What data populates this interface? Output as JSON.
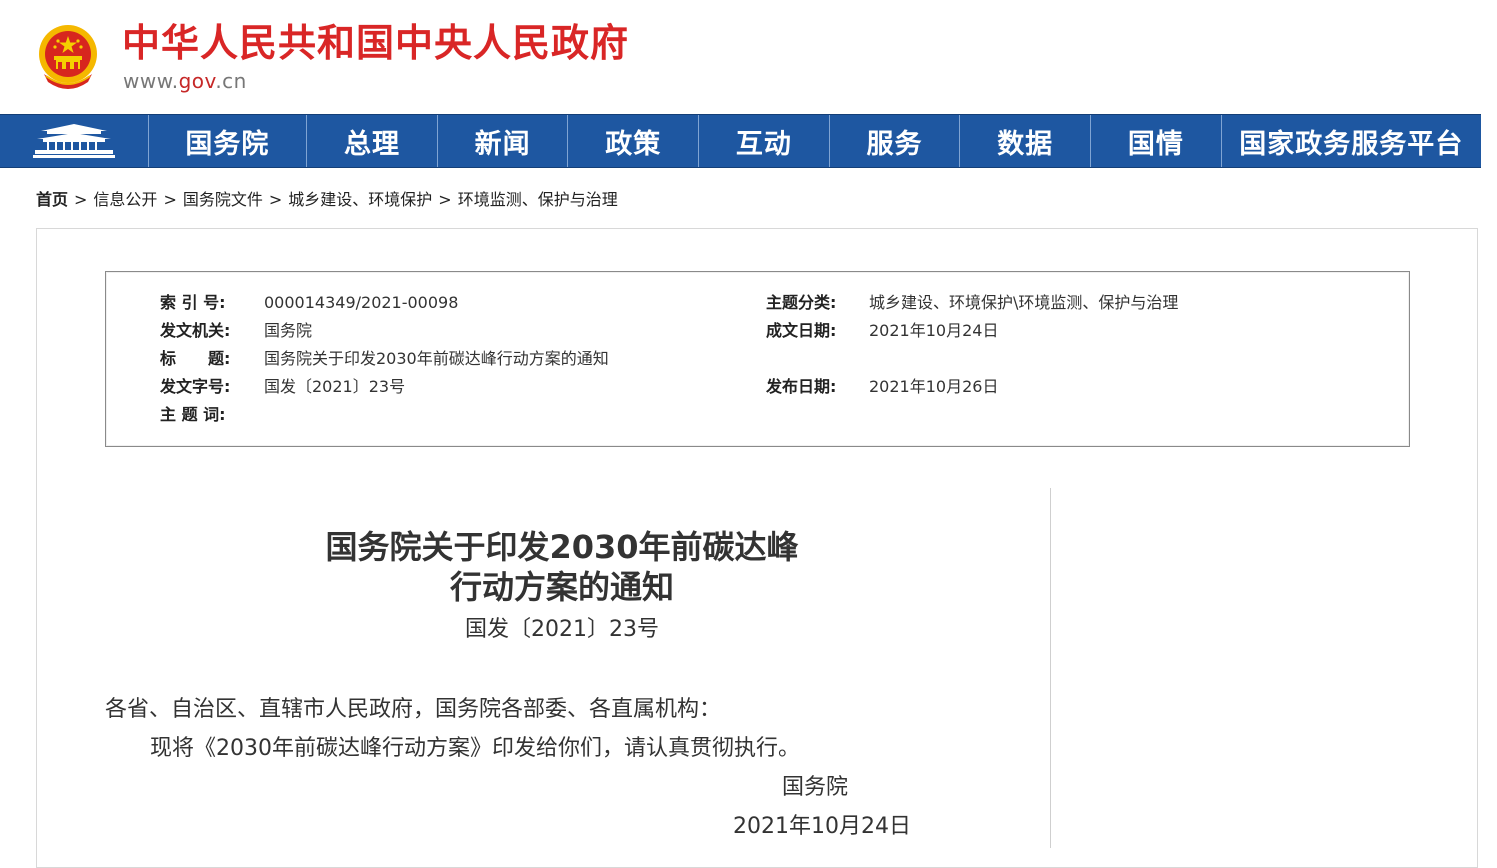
{
  "header": {
    "title": "中华人民共和国中央人民政府",
    "domain_prefix": "www.",
    "domain_gov": "gov",
    "domain_suffix": ".cn",
    "emblem_icon": "national-emblem-icon"
  },
  "nav": {
    "home_icon": "tiananmen-icon",
    "items": [
      "国务院",
      "总理",
      "新闻",
      "政策",
      "互动",
      "服务",
      "数据",
      "国情",
      "国家政务服务平台"
    ],
    "background": "#1e57a1"
  },
  "breadcrumb": {
    "items": [
      "首页",
      "信息公开",
      "国务院文件",
      "城乡建设、环境保护",
      "环境监测、保护与治理"
    ],
    "separator": ">"
  },
  "meta": {
    "index_label": "索 引 号:",
    "index_value": "000014349/2021-00098",
    "topic_label": "主题分类:",
    "topic_value": "城乡建设、环境保护\\环境监测、保护与治理",
    "issuer_label": "发文机关:",
    "issuer_value": "国务院",
    "date_written_label": "成文日期:",
    "date_written_value": "2021年10月24日",
    "title_label": "标　　题:",
    "title_value": "国务院关于印发2030年前碳达峰行动方案的通知",
    "doc_no_label": "发文字号:",
    "doc_no_value": "国发〔2021〕23号",
    "publish_date_label": "发布日期:",
    "publish_date_value": "2021年10月26日",
    "keywords_label": "主 题 词:",
    "keywords_value": ""
  },
  "document": {
    "title_line1": "国务院关于印发2030年前碳达峰",
    "title_line2": "行动方案的通知",
    "number": "国发〔2021〕23号",
    "salutation": "各省、自治区、直辖市人民政府，国务院各部委、各直属机构：",
    "body": "现将《2030年前碳达峰行动方案》印发给你们，请认真贯彻执行。",
    "signature": "国务院",
    "date": "2021年10月24日"
  }
}
